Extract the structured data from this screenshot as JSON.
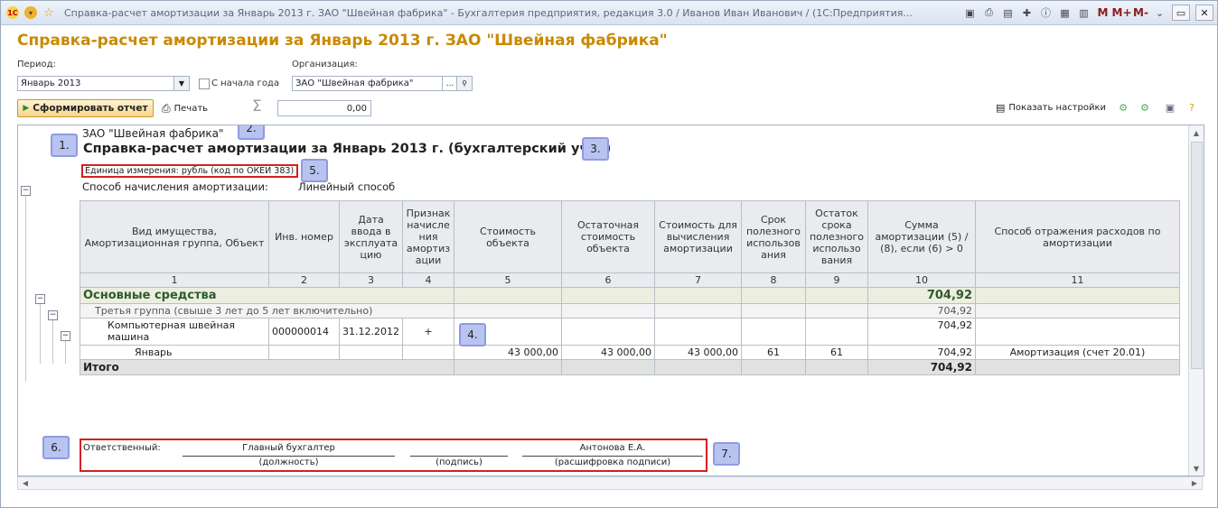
{
  "window": {
    "title": "Справка-расчет амортизации за Январь 2013 г. ЗАО \"Швейная фабрика\" - Бухгалтерия предприятия, редакция 3.0 / Иванов Иван Иванович / (1С:Предприятия...   (1С:Предприятие)",
    "app_badge": "1С",
    "memory_buttons": [
      "M",
      "M+",
      "M-"
    ]
  },
  "header": {
    "form_title": "Справка-расчет амортизации за Январь 2013 г. ЗАО \"Швейная фабрика\"",
    "period_label": "Период:",
    "period_value": "Январь 2013",
    "from_start_label": "С начала года",
    "org_label": "Организация:",
    "org_value": "ЗАО \"Швейная фабрика\"",
    "org_dots": "...",
    "generate_button": "Сформировать отчет",
    "print_button": "Печать",
    "sigma": "Σ",
    "sum_value": "0,00",
    "show_settings": "Показать настройки"
  },
  "report": {
    "org": "ЗАО \"Швейная фабрика\"",
    "title": "Справка-расчет амортизации за Январь 2013 г. (бухгалтерский учет)",
    "unit": "Единица измерения:   рубль (код по ОКЕИ 383)",
    "method_label": "Способ начисления амортизации:",
    "method_value": "Линейный способ",
    "columns": [
      "Вид имущества, Амортизационная группа, Объект",
      "Инв. номер",
      "Дата ввода в эксплуата цию",
      "Признак начисле ния амортиз ации",
      "Стоимость объекта",
      "Остаточная стоимость объекта",
      "Стоимость для вычисления амортизации",
      "Срок полезного использов ания",
      "Остаток срока полезного использо вания",
      "Сумма амортизации (5) / (8), если (6) > 0",
      "Способ отражения расходов по амортизации"
    ],
    "column_numbers": [
      "1",
      "2",
      "3",
      "4",
      "5",
      "6",
      "7",
      "8",
      "9",
      "10",
      "11"
    ],
    "group1": {
      "name": "Основные средства",
      "amount": "704,92"
    },
    "group2": {
      "name": "Третья группа (свыше 3 лет до 5 лет включительно)",
      "amount": "704,92"
    },
    "object": {
      "name": "Компьютерная швейная машина",
      "inv": "000000014",
      "date": "31.12.2012",
      "flag": "+",
      "amount": "704,92"
    },
    "month": {
      "name": "Январь",
      "cost": "43 000,00",
      "residual": "43 000,00",
      "calc_cost": "43 000,00",
      "term": "61",
      "remaining": "61",
      "amount": "704,92",
      "expense": "Амортизация (счет 20.01)"
    },
    "total": {
      "name": "Итого",
      "amount": "704,92"
    },
    "signature": {
      "responsible": "Ответственный:",
      "position_value": "Главный бухгалтер",
      "position_caption": "(должность)",
      "sign_caption": "(подпись)",
      "name_value": "Антонова Е.А.",
      "name_caption": "(расшифровка подписи)"
    }
  },
  "badges": [
    "1.",
    "2.",
    "3.",
    "4.",
    "5.",
    "6.",
    "7."
  ],
  "colors": {
    "title_gold": "#c98a00",
    "highlight_red": "#d42020",
    "badge_fill": "#b9c3ef"
  }
}
